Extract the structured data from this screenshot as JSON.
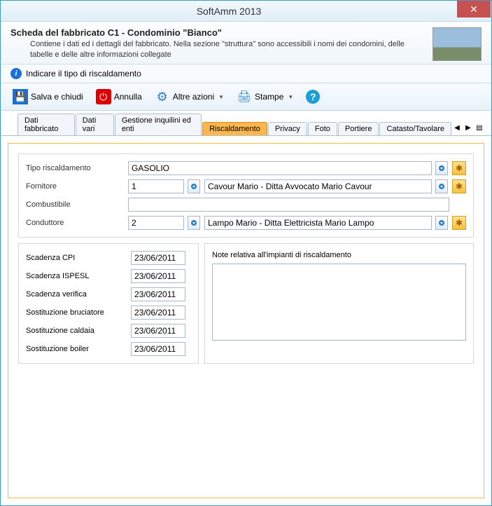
{
  "window": {
    "title": "SoftAmm 2013"
  },
  "header": {
    "title": "Scheda del fabbricato C1 - Condominio \"Bianco\"",
    "desc": "Contiene i dati ed i dettagli del fabbricato. Nella sezione \"struttura\" sono accessibili i nomi dei condomini, delle tabelle e delle altre informazioni collegate"
  },
  "info_text": "Indicare il tipo di riscaldamento",
  "toolbar": {
    "save": "Salva e chiudi",
    "cancel": "Annulla",
    "actions": "Altre azioni",
    "print": "Stampe"
  },
  "tabs": [
    {
      "label": "Dati fabbricato"
    },
    {
      "label": "Dati vari"
    },
    {
      "label": "Gestione inquilini ed enti"
    },
    {
      "label": "Riscaldamento",
      "active": true
    },
    {
      "label": "Privacy"
    },
    {
      "label": "Foto"
    },
    {
      "label": "Portiere"
    },
    {
      "label": "Catasto/Tavolare"
    }
  ],
  "form": {
    "tipo_riscaldamento_label": "Tipo riscaldamento",
    "tipo_riscaldamento_value": "GASOLIO",
    "fornitore_label": "Fornitore",
    "fornitore_code": "1",
    "fornitore_name": "Cavour Mario - Ditta Avvocato Mario Cavour",
    "combustibile_label": "Combustibile",
    "combustibile_value": "",
    "conduttore_label": "Conduttore",
    "conduttore_code": "2",
    "conduttore_name": "Lampo Mario - Ditta Elettricista Mario Lampo"
  },
  "dates": {
    "scadenza_cpi_label": "Scadenza CPI",
    "scadenza_cpi": "23/06/2011",
    "scadenza_ispesl_label": "Scadenza ISPESL",
    "scadenza_ispesl": "23/06/2011",
    "scadenza_verifica_label": "Scadenza verifica",
    "scadenza_verifica": "23/06/2011",
    "sost_bruciatore_label": "Sostituzione bruciatore",
    "sost_bruciatore": "23/06/2011",
    "sost_caldaia_label": "Sostituzione caldaia",
    "sost_caldaia": "23/06/2011",
    "sost_boiler_label": "Sostituzione boiler",
    "sost_boiler": "23/06/2011"
  },
  "notes": {
    "label": "Note relativa all'impianti di riscaldamento",
    "value": ""
  }
}
